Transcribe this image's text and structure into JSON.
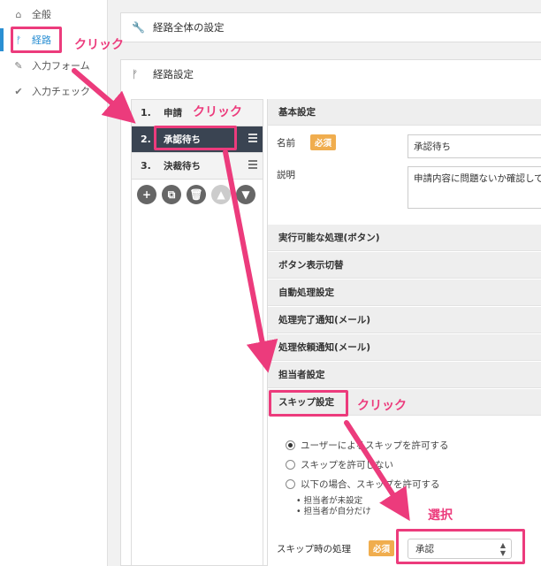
{
  "sidebar": {
    "items": [
      {
        "label": "全般",
        "icon": "home-icon"
      },
      {
        "label": "経路",
        "icon": "route-icon"
      },
      {
        "label": "入力フォーム",
        "icon": "pencil-icon"
      },
      {
        "label": "入力チェック",
        "icon": "check-icon"
      }
    ]
  },
  "panels": {
    "global_settings": "経路全体の設定",
    "route_settings": "経路設定"
  },
  "route_steps": [
    {
      "num": "1.",
      "label": "申請"
    },
    {
      "num": "2.",
      "label": "承認待ち"
    },
    {
      "num": "3.",
      "label": "決裁待ち"
    }
  ],
  "controls": [
    "+",
    "⧉",
    "🗑",
    "▲",
    "▼"
  ],
  "basic": {
    "header": "基本設定",
    "name_label": "名前",
    "required": "必須",
    "name_value": "承認待ち",
    "desc_label": "説明",
    "desc_value": "申請内容に問題ないか確認して、"
  },
  "sections": [
    "実行可能な処理(ボタン)",
    "ボタン表示切替",
    "自動処理設定",
    "処理完了通知(メール)",
    "処理依頼通知(メール)",
    "担当者設定",
    "スキップ設定"
  ],
  "skip": {
    "options": [
      "ユーザーによるスキップを許可する",
      "スキップを許可しない",
      "以下の場合、スキップを許可する"
    ],
    "bullets": [
      "担当者が未設定",
      "担当者が自分だけ"
    ],
    "process_label": "スキップ時の処理",
    "required": "必須",
    "process_value": "承認"
  },
  "annotations": {
    "click1": "クリック",
    "click2": "クリック",
    "click3": "クリック",
    "select": "選択"
  },
  "colors": {
    "accent": "#2b8fd3",
    "annotation": "#ec3b7c",
    "active_step": "#3a4452",
    "required": "#f0ad4e"
  }
}
